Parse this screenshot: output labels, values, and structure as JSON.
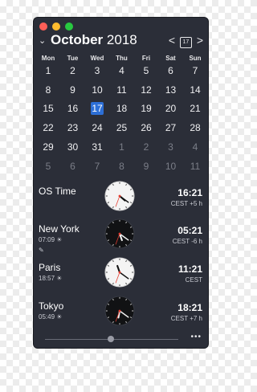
{
  "header": {
    "month": "October",
    "year": "2018",
    "prev": "<",
    "next": ">",
    "today_icon": "17"
  },
  "weekdays": [
    "Mon",
    "Tue",
    "Wed",
    "Thu",
    "Fri",
    "Sat",
    "Sun"
  ],
  "weeks": [
    [
      "1",
      "2",
      "3",
      "4",
      "5",
      "6",
      "7"
    ],
    [
      "8",
      "9",
      "10",
      "11",
      "12",
      "13",
      "14"
    ],
    [
      "15",
      "16",
      "17",
      "18",
      "19",
      "20",
      "21"
    ],
    [
      "22",
      "23",
      "24",
      "25",
      "26",
      "27",
      "28"
    ],
    [
      "29",
      "30",
      "31",
      "1",
      "2",
      "3",
      "4"
    ],
    [
      "5",
      "6",
      "7",
      "8",
      "9",
      "10",
      "11"
    ]
  ],
  "today": "17",
  "clocks": [
    {
      "city": "OS Time",
      "subtitle": "",
      "time": "16:21",
      "offset": "CEST +5 h",
      "face": "light",
      "hour": 4,
      "minute": 21
    },
    {
      "city": "New York",
      "subtitle": "07:09 ☀",
      "time": "05:21",
      "offset": "CEST -6 h",
      "face": "dark",
      "hour": 5,
      "minute": 21
    },
    {
      "city": "Paris",
      "subtitle": "18:57 ☀",
      "time": "11:21",
      "offset": "CEST",
      "face": "light",
      "hour": 11,
      "minute": 21
    },
    {
      "city": "Tokyo",
      "subtitle": "05:49 ☀",
      "time": "18:21",
      "offset": "CEST +7 h",
      "face": "dark",
      "hour": 6,
      "minute": 21
    }
  ],
  "pencil_icon": "✎",
  "more": "•••",
  "colors": {
    "window": "#2b2e38",
    "accent": "#2d6fd6",
    "muted": "#7b7e88"
  }
}
